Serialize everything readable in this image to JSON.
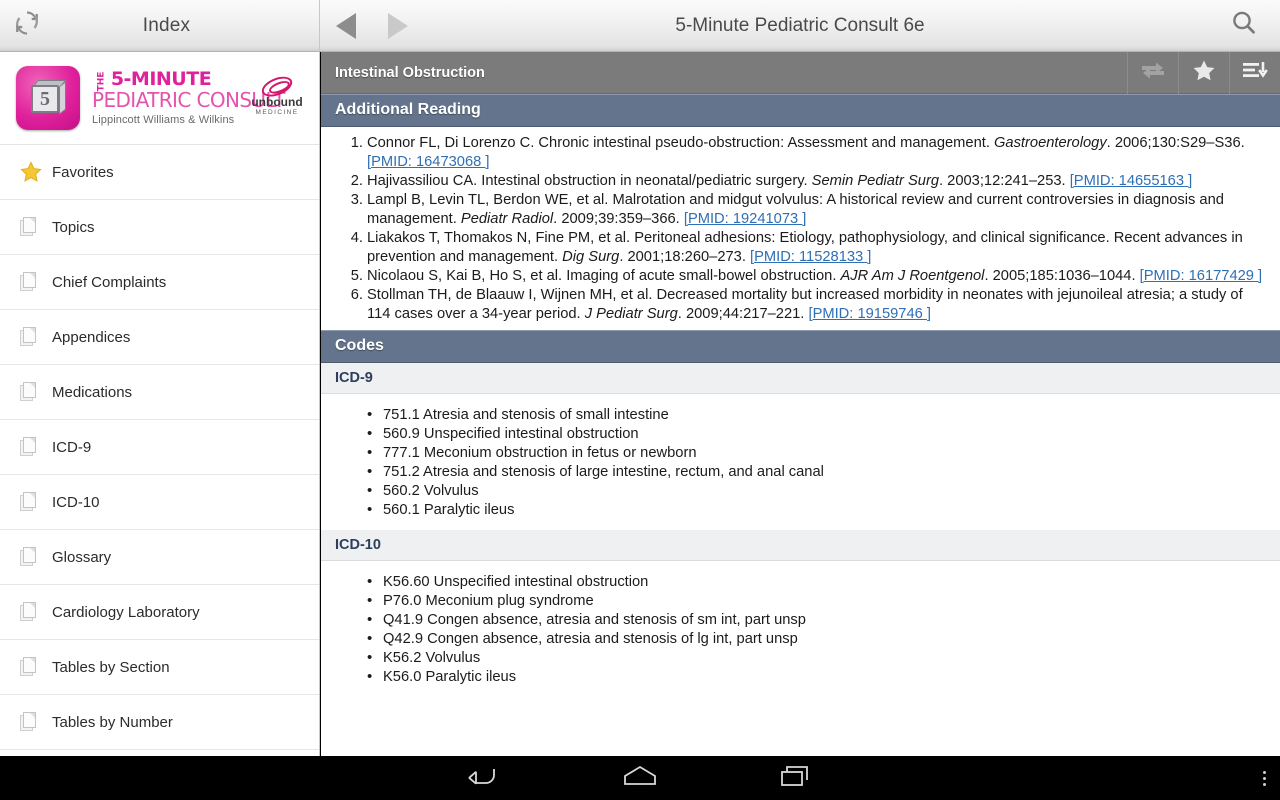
{
  "actionbar": {
    "refresh_icon": "refresh-icon",
    "index_title": "Index",
    "back_icon": "back-triangle-icon",
    "forward_icon": "forward-triangle-icon",
    "book_title": "5-Minute Pediatric Consult 6e",
    "search_icon": "search-icon"
  },
  "sidebar": {
    "logo": {
      "tile_glyph": "5",
      "the": "THE",
      "line1": "5-MINUTE",
      "line2": "PEDIATRIC CONSULT",
      "line3": "Lippincott Williams & Wilkins",
      "publisher_name": "unbound",
      "publisher_sub": "MEDICINE",
      "brand_pink": "#e0219c",
      "brand_magenta": "#d4166c"
    },
    "items": [
      {
        "label": "Favorites",
        "icon": "star-icon"
      },
      {
        "label": "Topics",
        "icon": "documents-icon"
      },
      {
        "label": "Chief Complaints",
        "icon": "documents-icon"
      },
      {
        "label": "Appendices",
        "icon": "documents-icon"
      },
      {
        "label": "Medications",
        "icon": "documents-icon"
      },
      {
        "label": "ICD-9",
        "icon": "documents-icon"
      },
      {
        "label": "ICD-10",
        "icon": "documents-icon"
      },
      {
        "label": "Glossary",
        "icon": "documents-icon"
      },
      {
        "label": "Cardiology Laboratory",
        "icon": "documents-icon"
      },
      {
        "label": "Tables by Section",
        "icon": "documents-icon"
      },
      {
        "label": "Tables by Number",
        "icon": "documents-icon"
      }
    ]
  },
  "content": {
    "topic_name": "Intestinal Obstruction",
    "toolbar": {
      "swap_icon": "two-way-arrow-icon",
      "favorite_icon": "star-icon",
      "outline_icon": "list-sort-icon"
    },
    "sections": [
      {
        "title": "Additional Reading"
      },
      {
        "title": "Codes"
      }
    ],
    "additional_reading": [
      {
        "pre": "Connor FL, Di Lorenzo C. Chronic intestinal pseudo-obstruction: Assessment and management. ",
        "journal": "Gastroenterology",
        "post": ". 2006;130:S29–S36. ",
        "pmid": "[PMID: 16473068 ]"
      },
      {
        "pre": "Hajivassiliou CA. Intestinal obstruction in neonatal/pediatric surgery. ",
        "journal": "Semin Pediatr Surg",
        "post": ". 2003;12:241–253. ",
        "pmid": "[PMID: 14655163 ]"
      },
      {
        "pre": "Lampl B, Levin TL, Berdon WE, et al. Malrotation and midgut volvulus: A historical review and current controversies in diagnosis and management. ",
        "journal": "Pediatr Radiol",
        "post": ". 2009;39:359–366. ",
        "pmid": "[PMID: 19241073 ]"
      },
      {
        "pre": "Liakakos T, Thomakos N, Fine PM, et al. Peritoneal adhesions: Etiology, pathophysiology, and clinical significance. Recent advances in prevention and management. ",
        "journal": "Dig Surg",
        "post": ". 2001;18:260–273. ",
        "pmid": "[PMID: 11528133 ]"
      },
      {
        "pre": "Nicolaou S, Kai B, Ho S, et al. Imaging of acute small-bowel obstruction. ",
        "journal": "AJR Am J Roentgenol",
        "post": ". 2005;185:1036–1044. ",
        "pmid": "[PMID: 16177429 ]"
      },
      {
        "pre": "Stollman TH, de Blaauw I, Wijnen MH, et al. Decreased mortality but increased morbidity in neonates with jejunoileal atresia; a study of 114 cases over a 34-year period. ",
        "journal": "J Pediatr Surg",
        "post": ". 2009;44:217–221. ",
        "pmid": "[PMID: 19159746 ]"
      }
    ],
    "icd9": {
      "title": "ICD-9",
      "codes": [
        "751.1 Atresia and stenosis of small intestine",
        "560.9 Unspecified intestinal obstruction",
        "777.1 Meconium obstruction in fetus or newborn",
        "751.2 Atresia and stenosis of large intestine, rectum, and anal canal",
        "560.2 Volvulus",
        "560.1 Paralytic ileus"
      ]
    },
    "icd10": {
      "title": "ICD-10",
      "codes": [
        "K56.60 Unspecified intestinal obstruction",
        "P76.0 Meconium plug syndrome",
        "Q41.9 Congen absence, atresia and stenosis of sm int, part unsp",
        "Q42.9 Congen absence, atresia and stenosis of lg int, part unsp",
        "K56.2 Volvulus",
        "K56.0 Paralytic ileus"
      ]
    }
  },
  "systembar": {
    "back_icon": "back-arrow-icon",
    "home_icon": "home-icon",
    "recents_icon": "recents-icon",
    "menu_icon": "overflow-menu-icon"
  },
  "colors": {
    "section_header": "#64748c",
    "topic_bar": "#7b7b7b",
    "link": "#2f6fb5",
    "subhead_text": "#2d3e5c"
  }
}
